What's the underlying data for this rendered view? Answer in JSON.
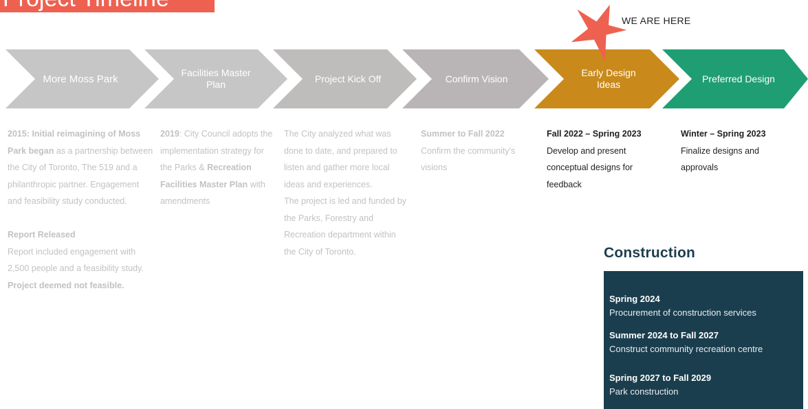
{
  "title": "Project Timeline",
  "marker": {
    "label": "WE ARE HERE",
    "color": "#ee6150"
  },
  "stages": [
    {
      "label": "More Moss Park",
      "color": "#c6c6c6",
      "status": "past"
    },
    {
      "label": "Facilities Master Plan",
      "color": "#c6c6c6",
      "status": "past"
    },
    {
      "label": "Project Kick Off",
      "color": "#bfbcbc",
      "status": "past"
    },
    {
      "label": "Confirm Vision",
      "color": "#b9b5b6",
      "status": "past"
    },
    {
      "label": "Early Design Ideas",
      "color": "#c98a1b",
      "status": "current"
    },
    {
      "label": "Preferred Design",
      "color": "#1f9e73",
      "status": "upcoming"
    }
  ],
  "columns": {
    "c1": {
      "heading": "2015: Initial reimagining of Moss Park began",
      "text": " as a partnership between the City of Toronto, The 519 and a philanthropic partner. Engagement and feasibility study conducted.",
      "report_heading": "Report Released",
      "report_text": "Report included engagement with 2,500 people and a feasibility study. ",
      "report_emph": "Project deemed not feasible."
    },
    "c2": {
      "year": "2019",
      "text1": ": City Council adopts the implementation strategy for the Parks & ",
      "emph": "Recreation Facilities Master Plan",
      "text2": " with amendments"
    },
    "c3": {
      "text1": "The City analyzed what was done to date, and prepared to listen and gather more local ideas and experiences.",
      "text2": "The project is led and funded by the Parks, Forestry and Recreation department within the City of Toronto."
    },
    "c4": {
      "heading": "Summer to Fall 2022",
      "text": "Confirm the community's visions"
    },
    "c5": {
      "heading": "Fall 2022 – Spring 2023",
      "text": "Develop and present conceptual designs for feedback"
    },
    "c6": {
      "heading": "Winter – Spring 2023",
      "text": "Finalize designs and approvals"
    }
  },
  "construction": {
    "title": "Construction",
    "items": [
      {
        "when": "Spring 2024",
        "what": "Procurement of construction services"
      },
      {
        "when": "Summer 2024 to Fall 2027",
        "what": "Construct community recreation centre"
      },
      {
        "when": "Spring 2027 to Fall 2029",
        "what": "Park construction"
      }
    ]
  },
  "colors": {
    "current": "#c98a1b",
    "upcoming": "#1f9e73",
    "past": "#c6c6c6",
    "construction": "#1b3e4e"
  }
}
